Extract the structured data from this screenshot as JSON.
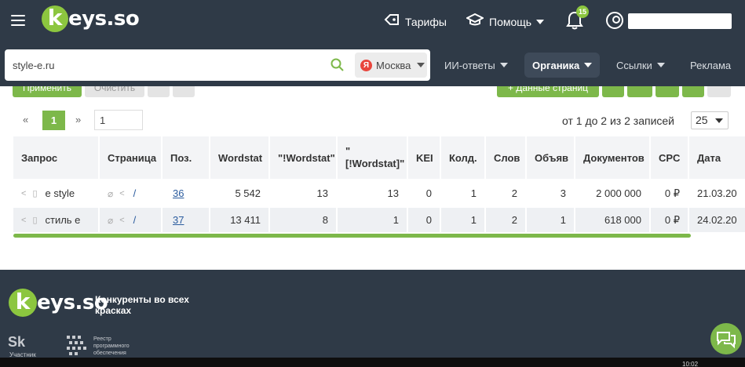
{
  "header": {
    "brand": "keys.so",
    "brand_letter": "k",
    "brand_rest": "eys.so",
    "tariffs": "Тарифы",
    "help": "Помощь",
    "notifications_count": "15"
  },
  "search": {
    "query": "style-e.ru",
    "region": "Москва",
    "region_engine": "Я"
  },
  "nav": {
    "items": [
      {
        "label": "ИИ-ответы"
      },
      {
        "label": "Органика"
      },
      {
        "label": "Ссылки"
      },
      {
        "label": "Реклама"
      }
    ]
  },
  "toolbar": {
    "apply": "Применить",
    "clear": "Очистить",
    "data_pages": "+ Данные страниц"
  },
  "pagination": {
    "prev": "«",
    "current": "1",
    "next": "»",
    "input_value": "1",
    "records": "от 1 до 2 из 2 записей",
    "per_page": "25"
  },
  "table": {
    "headers": {
      "query": "Запрос",
      "page": "Страница",
      "pos": "Поз.",
      "wordstat": "Wordstat",
      "wordstat_q": "\"!Wordstat\"",
      "wordstat_bq1": "\"",
      "wordstat_bq2": "[!Wordstat]\"",
      "kei": "KEI",
      "kold": "Колд.",
      "slov": "Слов",
      "obyav": "Объяв",
      "docs": "Документов",
      "cpc": "CPC",
      "date": "Дата"
    },
    "rows": [
      {
        "query": "e style",
        "page": "/",
        "pos": "36",
        "wordstat": "5 542",
        "wq": "13",
        "wbq": "13",
        "kei": "0",
        "kold": "1",
        "slov": "2",
        "obyav": "3",
        "docs": "2 000 000",
        "cpc": "0 ₽",
        "date": "21.03.20"
      },
      {
        "query": "стиль е",
        "page": "/",
        "pos": "37",
        "wordstat": "13 411",
        "wq": "8",
        "wbq": "1",
        "kei": "0",
        "kold": "1",
        "slov": "2",
        "obyav": "1",
        "docs": "618 000",
        "cpc": "0 ₽",
        "date": "24.02.20"
      }
    ]
  },
  "footer": {
    "brand_letter": "k",
    "brand_rest": "eys.so",
    "slogan": "Конкуренты во всех красках",
    "sk": "Sk",
    "sk_sub": "Участник",
    "reestr": "Реестр программного обеспечения"
  },
  "taskbar": {
    "time": "10:02"
  },
  "colors": {
    "header_bg": "#2f3a47",
    "accent_green": "#7db84a",
    "brand_green": "#8cc63f",
    "link": "#2b5c9e"
  }
}
